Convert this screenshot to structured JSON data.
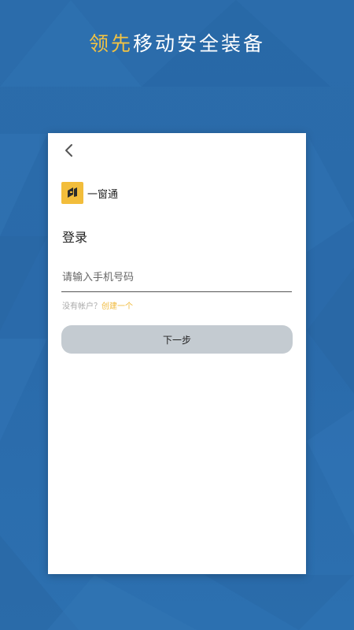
{
  "header": {
    "headline_accent": "领先",
    "headline_rest": "移动安全装备"
  },
  "login": {
    "back_icon": "chevron-left-icon",
    "brand": {
      "icon": "app-logo-icon",
      "name": "一窗通",
      "color": "#f2bd3b"
    },
    "title": "登录",
    "phone_input": {
      "value": "",
      "placeholder": "请输入手机号码"
    },
    "no_account_text": "没有帐户？",
    "create_link": "创建一个",
    "next_button": "下一步"
  },
  "colors": {
    "background": "#2a6aa8",
    "accent": "#f3c343",
    "button": "#c4cbd1",
    "link": "#f0b93a"
  }
}
